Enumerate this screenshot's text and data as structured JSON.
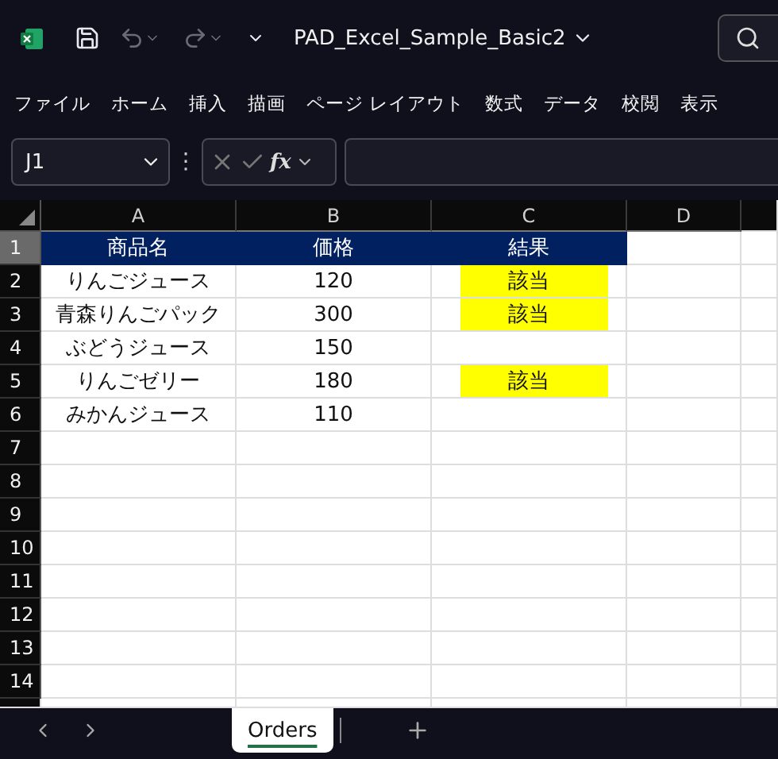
{
  "window": {
    "title": "PAD_Excel_Sample_Basic2"
  },
  "menu": [
    "ファイル",
    "ホーム",
    "挿入",
    "描画",
    "ページ レイアウト",
    "数式",
    "データ",
    "校閲",
    "表示"
  ],
  "formula_bar": {
    "name_box": "J1",
    "function_label": "fx",
    "more_label": "⋮"
  },
  "columns": [
    {
      "label": "A",
      "selected": false
    },
    {
      "label": "B",
      "selected": false
    },
    {
      "label": "C",
      "selected": false
    },
    {
      "label": "D",
      "selected": false
    }
  ],
  "rows": [
    {
      "number": "1",
      "selected": true,
      "kind": "header",
      "cells": [
        {
          "text": "商品名"
        },
        {
          "text": "価格"
        },
        {
          "text": "結果"
        }
      ]
    },
    {
      "number": "2",
      "selected": false,
      "kind": "data",
      "cells": [
        {
          "text": "りんごジュース",
          "highlight": false
        },
        {
          "text": "120",
          "highlight": false
        },
        {
          "text": "該当",
          "highlight": true
        }
      ]
    },
    {
      "number": "3",
      "selected": false,
      "kind": "data",
      "cells": [
        {
          "text": "青森りんごパック",
          "highlight": false
        },
        {
          "text": "300",
          "highlight": false
        },
        {
          "text": "該当",
          "highlight": true
        }
      ]
    },
    {
      "number": "4",
      "selected": false,
      "kind": "data",
      "cells": [
        {
          "text": "ぶどうジュース",
          "highlight": false
        },
        {
          "text": "150",
          "highlight": false
        },
        {
          "highlight": false
        }
      ]
    },
    {
      "number": "5",
      "selected": false,
      "kind": "data",
      "cells": [
        {
          "text": "りんごゼリー",
          "highlight": false
        },
        {
          "text": "180",
          "highlight": false
        },
        {
          "text": "該当",
          "highlight": true
        }
      ]
    },
    {
      "number": "6",
      "selected": false,
      "kind": "data",
      "cells": [
        {
          "text": "みかんジュース",
          "highlight": false
        },
        {
          "text": "110",
          "highlight": false
        },
        {
          "highlight": false
        }
      ]
    },
    {
      "number": "7",
      "selected": false,
      "kind": "data",
      "cells": []
    },
    {
      "number": "8",
      "selected": false,
      "kind": "data",
      "cells": []
    },
    {
      "number": "9",
      "selected": false,
      "kind": "data",
      "cells": []
    },
    {
      "number": "10",
      "selected": false,
      "kind": "data",
      "cells": []
    },
    {
      "number": "11",
      "selected": false,
      "kind": "data",
      "cells": []
    },
    {
      "number": "12",
      "selected": false,
      "kind": "data",
      "cells": []
    },
    {
      "number": "13",
      "selected": false,
      "kind": "data",
      "cells": []
    },
    {
      "number": "14",
      "selected": false,
      "kind": "data",
      "cells": []
    }
  ],
  "sheet_tabs": [
    {
      "label": "Orders",
      "selected": true
    }
  ]
}
